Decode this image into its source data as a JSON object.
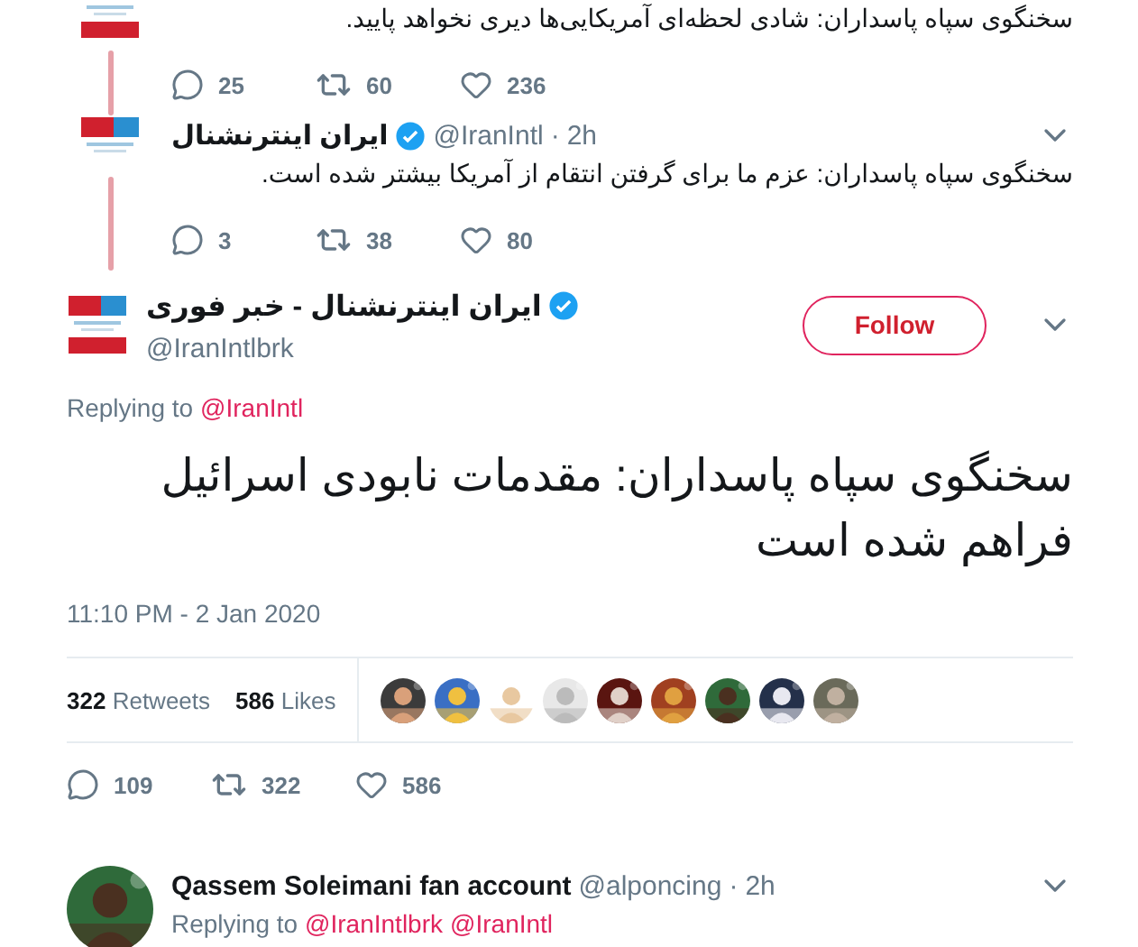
{
  "thread_tweets": [
    {
      "text": "سخنگوی سپاه پاسداران: شادی لحظه‌ای آمریکایی‌ها دیری نخواهد پایید.",
      "replies": "25",
      "retweets": "60",
      "likes": "236",
      "logo": {
        "kind": "breaking"
      }
    },
    {
      "name": "ایران اینترنشنال",
      "verified": true,
      "handle": "@IranIntl",
      "separator": "·",
      "time": "2h",
      "text": "سخنگوی سپاه پاسداران: عزم ما برای گرفتن انتقام از آمریکا بیشتر شده است.",
      "replies": "3",
      "retweets": "38",
      "likes": "80",
      "logo": {
        "kind": "main"
      }
    }
  ],
  "main_tweet": {
    "name": "ایران اینترنشنال - خبر فوری",
    "verified": true,
    "handle": "@IranIntlbrk",
    "follow_label": "Follow",
    "replying_label": "Replying to",
    "replying_to": [
      "@IranIntl"
    ],
    "text": "سخنگوی سپاه پاسداران: مقدمات نابودی اسرائیل فراهم شده است",
    "timestamp": "11:10 PM - 2 Jan 2020",
    "retweet_count": "322",
    "retweet_label": "Retweets",
    "like_count": "586",
    "like_label": "Likes",
    "liker_avatars": [
      {
        "kind": "picture"
      },
      {
        "kind": "picture"
      },
      {
        "kind": "picture"
      },
      {
        "kind": "picture"
      },
      {
        "kind": "picture"
      },
      {
        "kind": "picture"
      },
      {
        "kind": "picture"
      },
      {
        "kind": "picture"
      },
      {
        "kind": "picture"
      }
    ],
    "replies": "109",
    "retweets": "322",
    "likes": "586"
  },
  "reply": {
    "name": "Qassem Soleimani fan account",
    "handle": "@alponcing",
    "separator": "·",
    "time": "2h",
    "replying_label": "Replying to",
    "replying_to": [
      "@IranIntlbrk",
      "@IranIntl"
    ]
  }
}
